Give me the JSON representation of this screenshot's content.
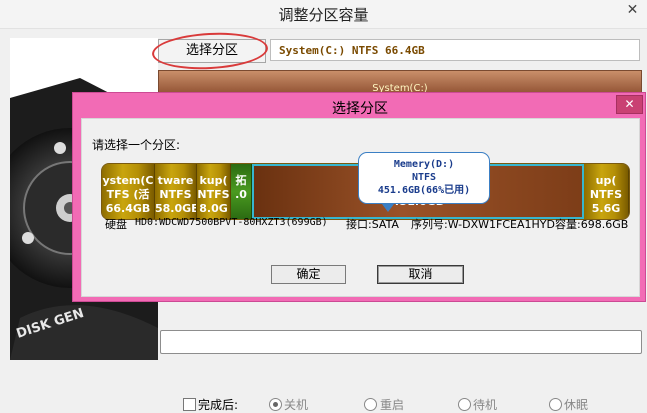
{
  "window": {
    "title": "调整分区容量",
    "close_glyph": "✕"
  },
  "main": {
    "select_partition_button": "选择分区",
    "selected_partition_info": "System(C:) NTFS 66.4GB",
    "bar_label": "System(C:)",
    "after_complete_label": "完成后:",
    "radio_options": [
      "关机",
      "重启",
      "待机",
      "休眠"
    ]
  },
  "dialog": {
    "title": "选择分区",
    "close_glyph": "✕",
    "prompt": "请选择一个分区:",
    "partitions": [
      {
        "line1": "ystem(C",
        "line2": "TFS (活",
        "line3": "66.4GB"
      },
      {
        "line1": "tware",
        "line2": "NTFS",
        "line3": "58.0GE"
      },
      {
        "line1": "kup(",
        "line2": "NTFS",
        "line3": "8.0G"
      },
      {
        "line1": "拓",
        "line2": ".0"
      },
      {
        "line1": "NTFS",
        "line2": "451.6GB"
      },
      {
        "line1": "up(",
        "line2": "NTFS",
        "line3": "5.6G"
      }
    ],
    "tooltip": {
      "line1": "Memery(D:)",
      "line2": "NTFS",
      "line3": "451.6GB(66%已用)"
    },
    "disk_info": {
      "label": "硬盘",
      "model": "HD0:WDCWD7500BPVT-80HXZT3(699GB)",
      "interface": "接口:SATA",
      "serial": "序列号:W-DXW1FCEA1HYD",
      "capacity": "容量:698.6GB"
    },
    "ok_button": "确定",
    "cancel_button": "取消"
  },
  "colors": {
    "dialog_frame": "#f26bb5",
    "selected_outline": "#36b6cf",
    "annotation_circle": "#d93a3a"
  }
}
